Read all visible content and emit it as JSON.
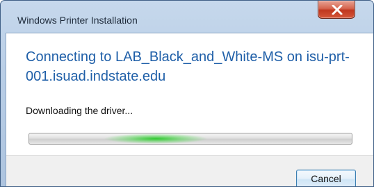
{
  "window": {
    "title": "Windows Printer Installation",
    "close_icon": "close-x-icon"
  },
  "main": {
    "heading": "Connecting to LAB_Black_and_White-MS on isu-prt-001.isuad.indstate.edu",
    "status": "Downloading the driver...",
    "progress": {
      "mode": "indeterminate",
      "accent": "#28c828"
    }
  },
  "footer": {
    "cancel_label": "Cancel"
  },
  "colors": {
    "heading": "#1f5fa8",
    "close_button": "#c0371f"
  }
}
